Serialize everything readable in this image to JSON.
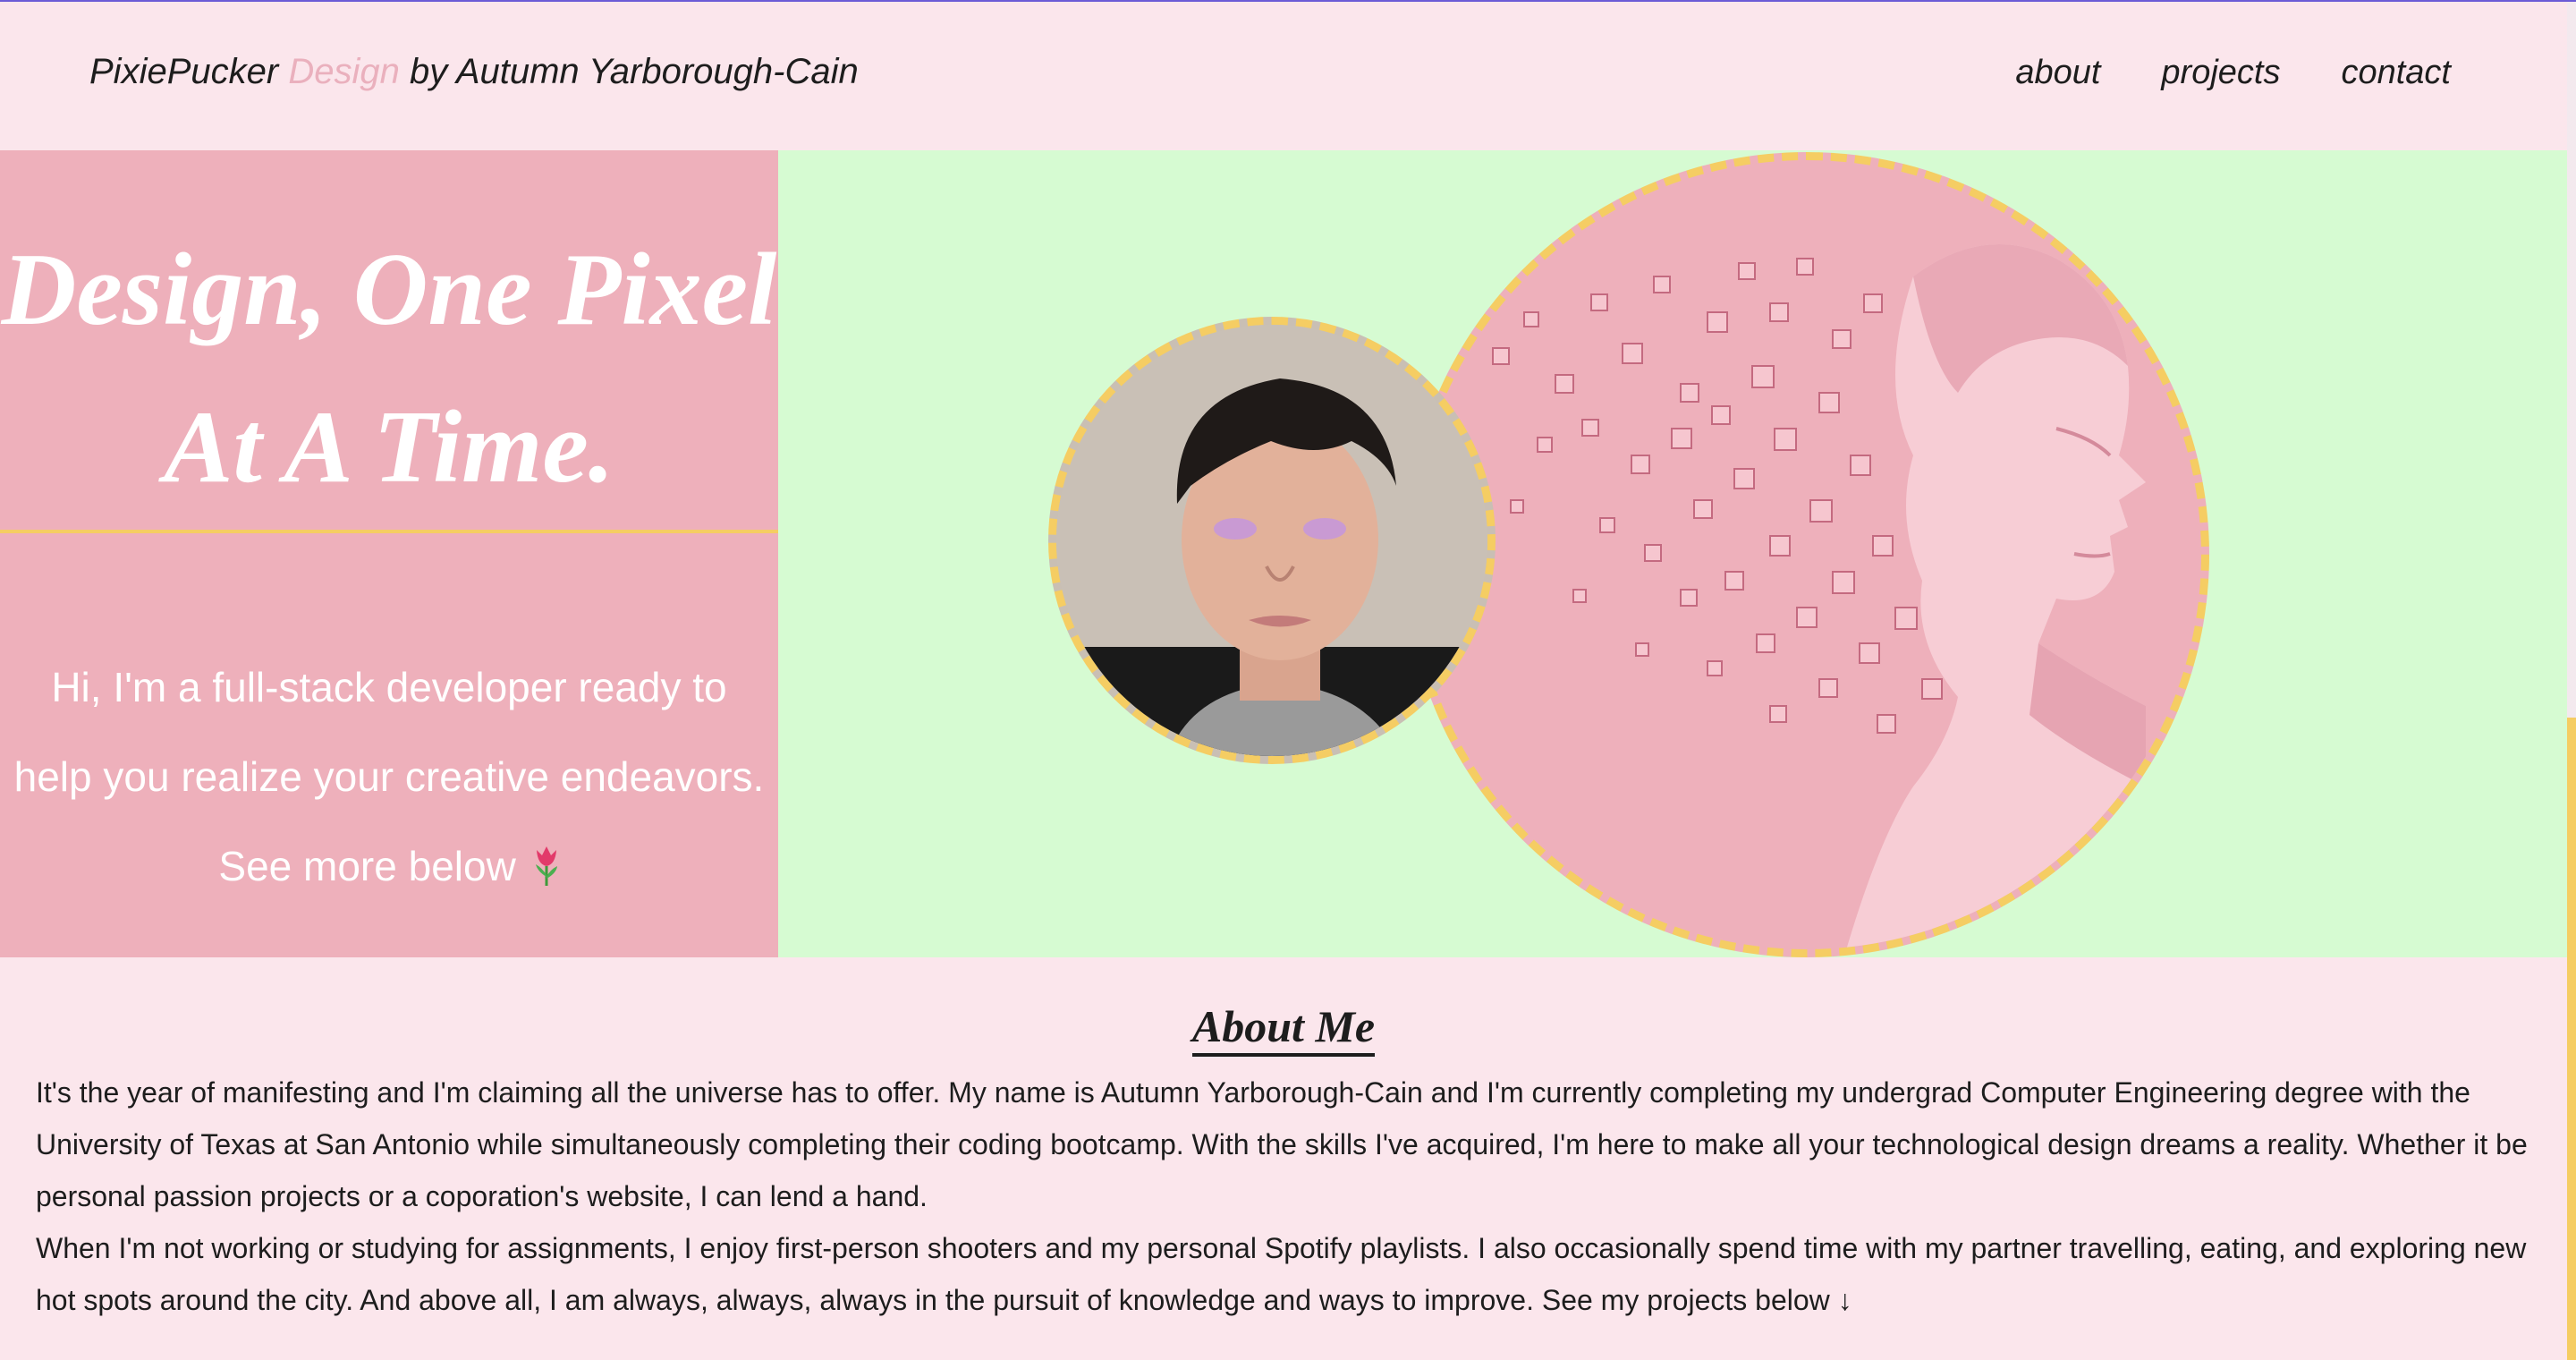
{
  "header": {
    "brand_part1": "PixiePucker ",
    "brand_accent": "Design",
    "brand_part2": " by Autumn Yarborough-Cain",
    "nav": [
      "about",
      "projects",
      "contact"
    ]
  },
  "hero": {
    "title": "Design, One Pixel At A Time.",
    "intro": "Hi, I'm a full-stack developer ready to help you realize your creative endeavors. See more below"
  },
  "about": {
    "heading": "About Me",
    "paragraph1": "It's the year of manifesting and I'm claiming all the universe has to offer. My name is Autumn Yarborough-Cain and I'm currently completing my undergrad Computer Engineering degree with the University of Texas at San Antonio while simultaneously completing their coding bootcamp. With the skills I've acquired, I'm here to make all your technological design dreams a reality. Whether it be personal passion projects or a coporation's website, I can lend a hand.",
    "paragraph2": "When I'm not working or studying for assignments, I enjoy first-person shooters and my personal Spotify playlists. I also occasionally spend time with my partner travelling, eating, and exploring new hot spots around the city. And above all, I am always, always, always in the pursuit of knowledge and ways to improve. See my projects below ↓"
  },
  "colors": {
    "background": "#fbe6ec",
    "pink": "#eeb0bb",
    "green": "#d6fbd2",
    "accent_yellow": "#f5cd63",
    "brand_accent": "#eab0bd"
  },
  "icons": {
    "tulip": "tulip-icon"
  }
}
